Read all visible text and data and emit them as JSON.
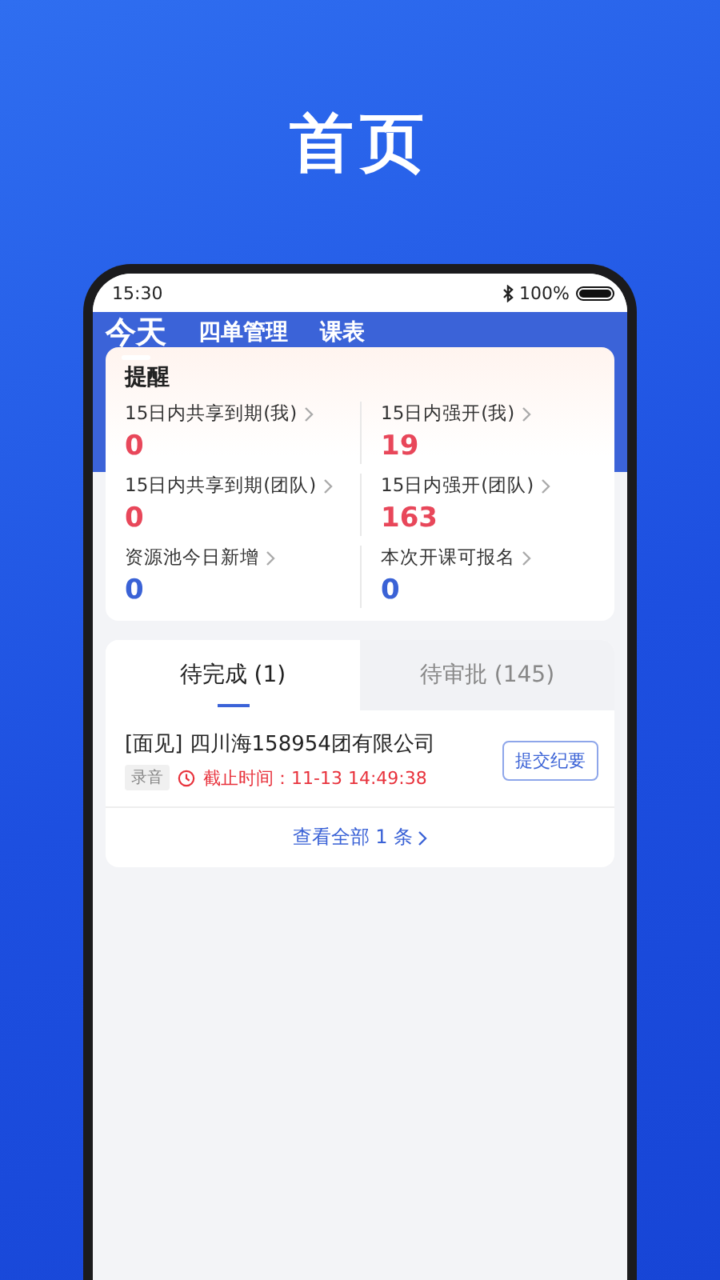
{
  "page_title": "首页",
  "status_bar": {
    "time": "15:30",
    "battery": "100%"
  },
  "top_tabs": [
    {
      "label": "今天",
      "selected": true
    },
    {
      "label": "四单管理",
      "selected": false
    },
    {
      "label": "课表",
      "selected": false
    }
  ],
  "reminder": {
    "title": "提醒",
    "metrics": [
      {
        "label": "15日内共享到期(我)",
        "value": "0",
        "color": "#e8475a"
      },
      {
        "label": "15日内强开(我)",
        "value": "19",
        "color": "#e8475a"
      },
      {
        "label": "15日内共享到期(团队)",
        "value": "0",
        "color": "#e8475a"
      },
      {
        "label": "15日内强开(团队)",
        "value": "163",
        "color": "#e8475a"
      },
      {
        "label": "资源池今日新增",
        "value": "0",
        "color": "#3a62d6"
      },
      {
        "label": "本次开课可报名",
        "value": "0",
        "color": "#3a62d6"
      }
    ]
  },
  "task_tabs": [
    {
      "label": "待完成 (1)",
      "selected": true
    },
    {
      "label": "待审批 (145)",
      "selected": false
    }
  ],
  "tasks": [
    {
      "title": "[面见] 四川海158954团有限公司",
      "tag": "录音",
      "deadline": "截止时间：11-13 14:49:38",
      "action": "提交纪要"
    }
  ],
  "view_all": "查看全部 1 条"
}
